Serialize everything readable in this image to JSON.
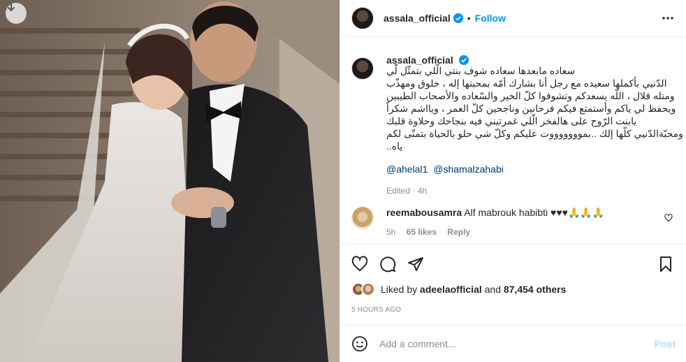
{
  "media": {
    "download_icon": "download-arrow-icon"
  },
  "header": {
    "username": "assala_official",
    "dot": "•",
    "follow_label": "Follow",
    "more_icon": "more-dots-icon"
  },
  "caption": {
    "username": "assala_official",
    "lines": [
      "سعاده مابعدها سعاده شوف بنتي الّلي بتمثّل لّي",
      "الدّنيي بأكملها سعيده مع رجل أنا بشارك أمّه بمحبتها إله ، خلوق ومهذّب",
      "ومتله قلال ، اللّه يسعدكم وتشوفوا كلّ الخير والسّعاده والأصحاب الطيبين",
      "ويحفظ لي ياكم وأستمتع فيكم فرحانين وناجحين كلّ العمر ، ويااشم شكراً",
      "يابنت الرّوح على هالفخر الّلي غمرتيني فيه بنجاحك وحلاوة قلبك",
      "ومحبّةالدّنيي كلّها إلك ..بموووووووت عليكم وكلّ شي حلو بالحياة بتمنّى لكم",
      "ياه.."
    ],
    "mentions": [
      "@ahelal1",
      "@shamalzahabi"
    ],
    "edited": "Edited · 4h"
  },
  "comment": {
    "username": "reemabousamra",
    "text": "Alf mabrouk habibti ♥♥♥🙏🙏🙏",
    "time": "5h",
    "likes": "65 likes",
    "reply": "Reply"
  },
  "actions": {
    "like_icon": "heart-icon",
    "comment_icon": "comment-icon",
    "share_icon": "send-icon",
    "save_icon": "bookmark-icon"
  },
  "likes": {
    "prefix": "Liked by",
    "user": "adeelaofficial",
    "and": "and",
    "others": "87,454 others"
  },
  "timestamp": "5 HOURS AGO",
  "add_comment": {
    "placeholder": "Add a comment...",
    "post_label": "Post",
    "emoji_icon": "emoji-icon"
  },
  "colors": {
    "accent": "#0095f6",
    "post_disabled": "#b2dffc",
    "muted": "#8e8e8e",
    "mention": "#00376b"
  }
}
